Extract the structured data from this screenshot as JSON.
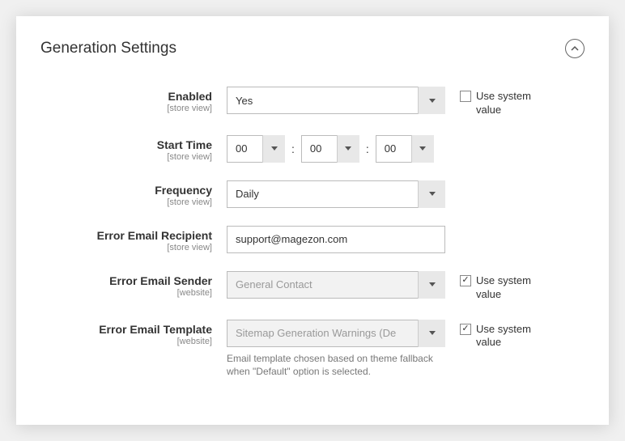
{
  "panel": {
    "title": "Generation Settings"
  },
  "fields": {
    "enabled": {
      "label": "Enabled",
      "scope": "[store view]",
      "value": "Yes",
      "systemLabel": "Use system value",
      "systemChecked": false
    },
    "startTime": {
      "label": "Start Time",
      "scope": "[store view]",
      "hour": "00",
      "minute": "00",
      "second": "00"
    },
    "frequency": {
      "label": "Frequency",
      "scope": "[store view]",
      "value": "Daily"
    },
    "errorRecipient": {
      "label": "Error Email Recipient",
      "scope": "[store view]",
      "value": "support@magezon.com"
    },
    "errorSender": {
      "label": "Error Email Sender",
      "scope": "[website]",
      "value": "General Contact",
      "systemLabel": "Use system value",
      "systemChecked": true
    },
    "errorTemplate": {
      "label": "Error Email Template",
      "scope": "[website]",
      "value": "Sitemap Generation Warnings (De",
      "systemLabel": "Use system value",
      "systemChecked": true,
      "helper": "Email template chosen based on theme fallback when \"Default\" option is selected."
    }
  }
}
